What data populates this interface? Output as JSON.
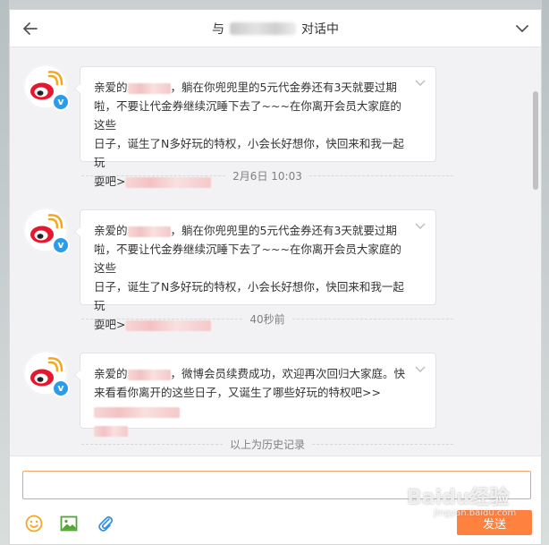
{
  "header": {
    "title_prefix": "与",
    "title_suffix": "对话中"
  },
  "messages": [
    {
      "lines": [
        [
          "亲爱的",
          "REDACT",
          "，躺在你兜兜里的5元代金券还有3天就要过期"
        ],
        [
          "啦，不要让代金券继续沉睡下去了~~~在你离开会员大家庭的这些"
        ],
        [
          "日子，诞生了N多好玩的特权，小会长好想你，快回来和我一起玩"
        ],
        [
          "耍吧>",
          "REDACT"
        ]
      ]
    },
    {
      "lines": [
        [
          "亲爱的",
          "REDACT",
          "，躺在你兜兜里的5元代金券还有3天就要过期"
        ],
        [
          "啦，不要让代金券继续沉睡下去了~~~在你离开会员大家庭的这些"
        ],
        [
          "日子，诞生了N多好玩的特权，小会长好想你，快回来和我一起玩"
        ],
        [
          "耍吧>",
          "REDACT"
        ]
      ]
    },
    {
      "lines": [
        [
          "亲爱的",
          "REDACT",
          "，微博会员续费成功，欢迎再次回归大家庭。快"
        ],
        [
          "来看看你离开的这些日子，又诞生了哪些好玩的特权吧>>",
          "REDACT"
        ],
        [
          "REDACT"
        ]
      ]
    }
  ],
  "timestamps": [
    "2月6日 10:03",
    "40秒前"
  ],
  "history_label": "以上为历史记录",
  "composer": {
    "input_value": "",
    "send_label": "发送"
  },
  "watermark": {
    "main": "Baidu经验",
    "sub": "jingyan.baidu.com"
  },
  "colors": {
    "accent": "#ff8140",
    "verified_badge": "#2a9dea",
    "weibo_red": "#e6162d",
    "weibo_orange": "#f5a623"
  },
  "icons": [
    "back-arrow-icon",
    "chevron-down-icon",
    "weibo-logo-icon",
    "verified-v-icon",
    "emoji-icon",
    "image-icon",
    "attachment-icon"
  ]
}
